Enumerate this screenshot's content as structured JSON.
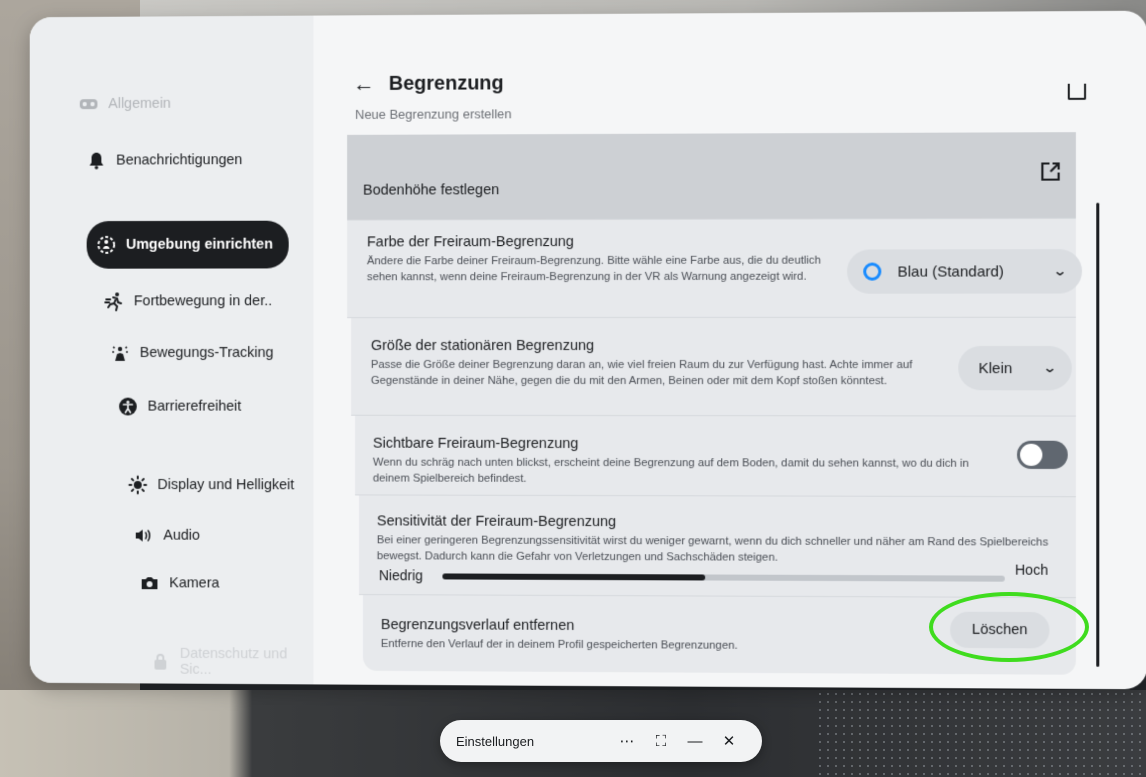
{
  "sidebar": {
    "items": [
      {
        "label": "Allgemein",
        "icon": "vr-headset-icon"
      },
      {
        "label": "Benachrichtigungen",
        "icon": "bell-icon"
      },
      {
        "label": "Umgebung einrichten",
        "icon": "environment-icon"
      },
      {
        "label": "Fortbewegung in der..",
        "icon": "running-person-icon"
      },
      {
        "label": "Bewegungs-Tracking",
        "icon": "motion-tracking-icon"
      },
      {
        "label": "Barrierefreiheit",
        "icon": "accessibility-icon"
      },
      {
        "label": "Display und Helligkeit",
        "icon": "sun-icon"
      },
      {
        "label": "Audio",
        "icon": "speaker-icon"
      },
      {
        "label": "Kamera",
        "icon": "camera-icon"
      },
      {
        "label": "Datenschutz und Sic...",
        "icon": "lock-icon"
      }
    ]
  },
  "header": {
    "title": "Begrenzung",
    "partial_row": "Neue Begrenzung erstellen"
  },
  "rows": {
    "floor": {
      "title": "Bodenhöhe festlegen"
    },
    "color": {
      "title": "Farbe der Freiraum-Begrenzung",
      "desc": "Ändere die Farbe deiner Freiraum-Begrenzung. Bitte wähle eine Farbe aus, die du deutlich sehen kannst, wenn deine Freiraum-Begrenzung in der VR als Warnung angezeigt wird.",
      "value": "Blau (Standard)",
      "ring_color": "#1a8cff"
    },
    "size": {
      "title": "Größe der stationären Begrenzung",
      "desc": "Passe die Größe deiner Begrenzung daran an, wie viel freien Raum du zur Verfügung hast. Achte immer auf Gegenstände in deiner Nähe, gegen die du mit den Armen, Beinen oder mit dem Kopf stoßen könntest.",
      "value": "Klein"
    },
    "visible": {
      "title": "Sichtbare Freiraum-Begrenzung",
      "desc": "Wenn du schräg nach unten blickst, erscheint deine Begrenzung auf dem Boden, damit du sehen kannst, wo du dich in deinem Spielbereich befindest.",
      "enabled": false
    },
    "sensitivity": {
      "title": "Sensitivität der Freiraum-Begrenzung",
      "desc": "Bei einer geringeren Begrenzungssensitivität wirst du weniger gewarnt, wenn du dich schneller und näher am Rand des Spielbereichs bewegst. Dadurch kann die Gefahr von Verletzungen und Sachschäden steigen.",
      "min_label": "Niedrig",
      "max_label": "Hoch",
      "level": 0.47
    },
    "history": {
      "title": "Begrenzungsverlauf entfernen",
      "desc": "Entferne den Verlauf der in deinem Profil gespeicherten Begrenzungen.",
      "button": "Löschen",
      "highlight_color": "#3fdc1e"
    }
  },
  "taskbar": {
    "title": "Einstellungen",
    "more": "⋯",
    "expand": "⛶",
    "minimize": "—",
    "close": "✕"
  }
}
